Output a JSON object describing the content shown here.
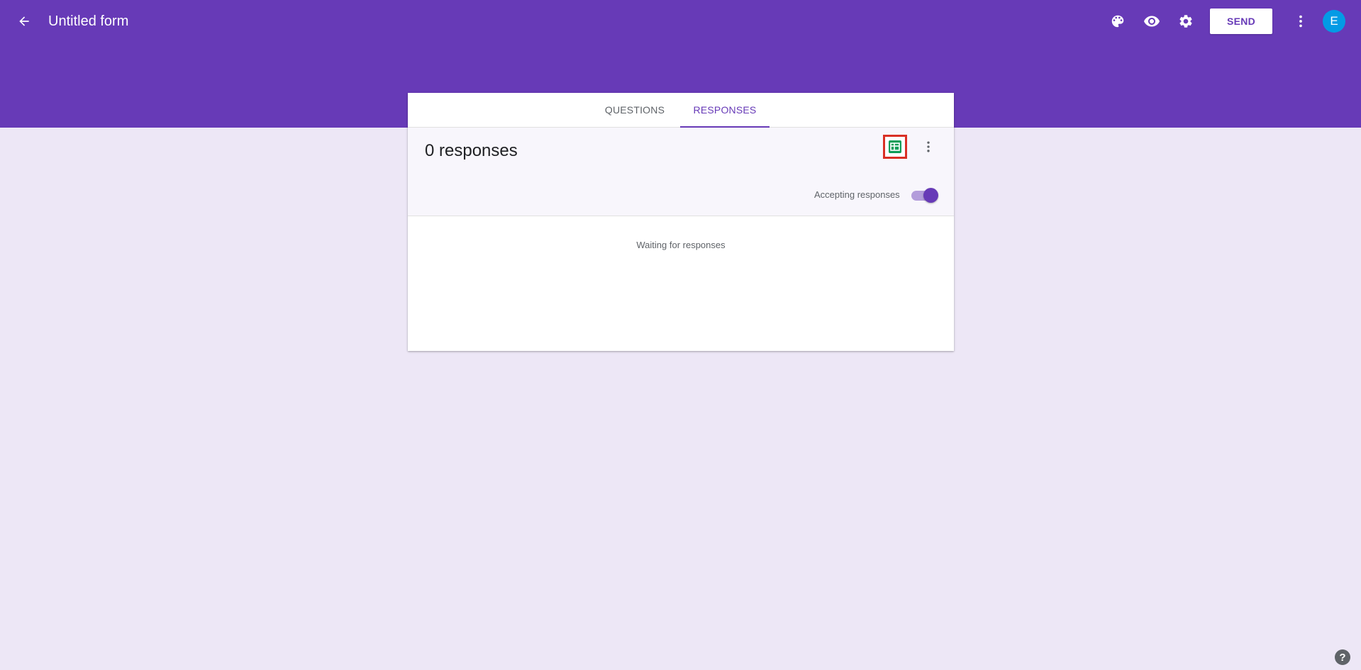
{
  "app": {
    "title": "Untitled form"
  },
  "toolbar": {
    "icons": [
      "back-arrow-icon",
      "palette-icon",
      "eye-icon",
      "gear-icon",
      "more-vert-icon"
    ],
    "send_label": "SEND",
    "avatar_letter": "E"
  },
  "tabs": [
    {
      "label": "QUESTIONS",
      "active": false
    },
    {
      "label": "RESPONSES",
      "active": true
    }
  ],
  "responses": {
    "count_text": "0 responses",
    "accepting_label": "Accepting responses",
    "accepting": true,
    "empty_text": "Waiting for responses"
  },
  "help": {
    "glyph": "?"
  },
  "colors": {
    "primary": "#673ab7",
    "background": "#ede7f6",
    "sheets_green": "#0f9d58",
    "highlight": "#d93025",
    "avatar": "#039be5"
  }
}
